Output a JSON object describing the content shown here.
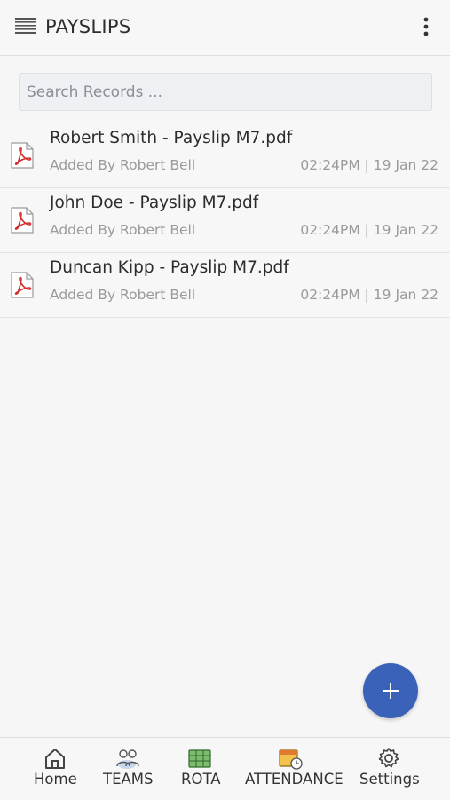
{
  "header": {
    "title": "PAYSLIPS",
    "menu_icon": "hamburger-menu-icon",
    "more_icon": "more-vertical-icon"
  },
  "search": {
    "placeholder": "Search Records ...",
    "value": ""
  },
  "records": [
    {
      "file_name": "Robert Smith - Payslip M7.pdf",
      "added_by": "Added By Robert Bell",
      "time": "02:24PM",
      "date": "19 Jan 22",
      "timestamp": "02:24PM | 19 Jan 22",
      "icon": "pdf-file-icon"
    },
    {
      "file_name": "John Doe - Payslip M7.pdf",
      "added_by": "Added By Robert Bell",
      "time": "02:24PM",
      "date": "19 Jan 22",
      "timestamp": "02:24PM | 19 Jan 22",
      "icon": "pdf-file-icon"
    },
    {
      "file_name": "Duncan Kipp - Payslip M7.pdf",
      "added_by": "Added By Robert Bell",
      "time": "02:24PM",
      "date": "19 Jan 22",
      "timestamp": "02:24PM | 19 Jan 22",
      "icon": "pdf-file-icon"
    }
  ],
  "fab": {
    "icon": "plus-icon"
  },
  "bottom_nav": {
    "items": [
      {
        "label": "Home",
        "icon": "home-icon"
      },
      {
        "label": "TEAMS",
        "icon": "teams-icon"
      },
      {
        "label": "ROTA",
        "icon": "rota-icon"
      },
      {
        "label": "ATTENDANCE",
        "icon": "attendance-icon"
      },
      {
        "label": "Settings",
        "icon": "gear-icon"
      }
    ]
  },
  "colors": {
    "accent": "#3a62b8",
    "pdf_red": "#d12b2b",
    "background": "#f6f6f7",
    "muted_text": "#9a9a9a"
  }
}
